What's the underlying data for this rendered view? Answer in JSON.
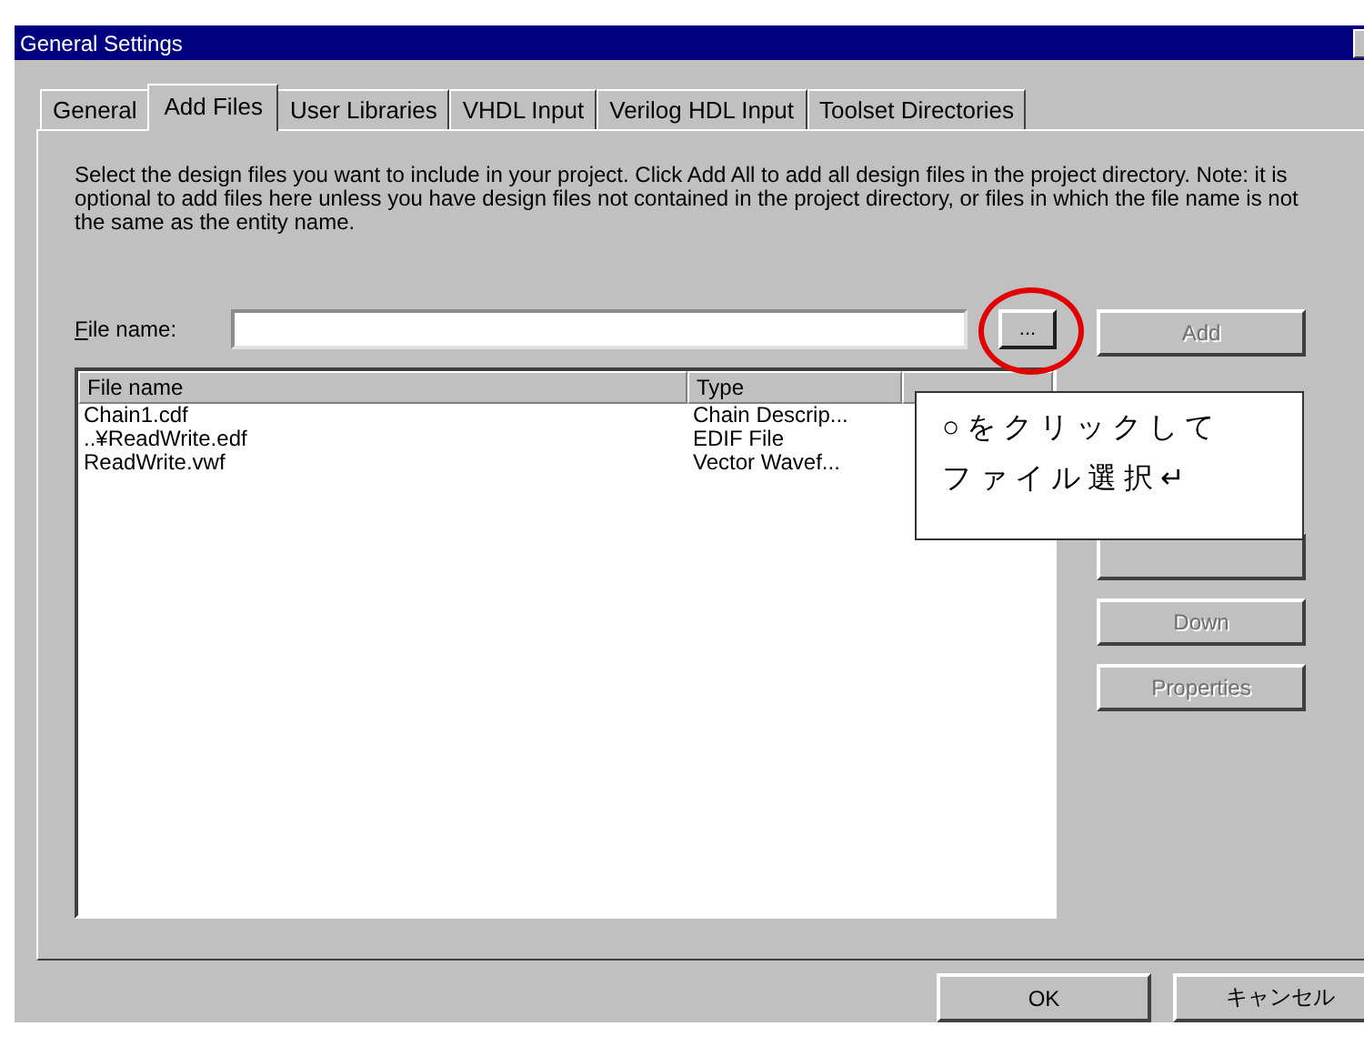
{
  "window": {
    "title": "General Settings"
  },
  "tabs": [
    {
      "label": "General",
      "selected": false
    },
    {
      "label": "Add Files",
      "selected": true
    },
    {
      "label": "User Libraries",
      "selected": false
    },
    {
      "label": "VHDL Input",
      "selected": false
    },
    {
      "label": "Verilog HDL Input",
      "selected": false
    },
    {
      "label": "Toolset Directories",
      "selected": false
    }
  ],
  "description": "Select the design files you want to include in your project.  Click Add All to add all design files in the project directory.  Note: it is optional to add files here unless you have design files not contained in the project directory, or files in which the file name is not the same as the entity name.",
  "file_name": {
    "label": "File name:",
    "browse_button": "..."
  },
  "side_buttons": [
    {
      "kind": "button",
      "label": "Add",
      "disabled": true
    },
    {
      "kind": "covered"
    },
    {
      "kind": "button",
      "label": "Down",
      "disabled": true
    },
    {
      "kind": "button",
      "label": "Properties",
      "disabled": true
    }
  ],
  "table": {
    "columns": [
      "File name",
      "Type"
    ],
    "rows": [
      [
        "Chain1.cdf",
        "Chain Descrip..."
      ],
      [
        "..¥ReadWrite.edf",
        "EDIF File"
      ],
      [
        "ReadWrite.vwf",
        "Vector Wavef..."
      ]
    ]
  },
  "callout": {
    "lines": [
      "○をクリックして",
      "ファイル選択↵"
    ]
  },
  "footer_buttons": [
    "OK",
    "キャンセル"
  ]
}
